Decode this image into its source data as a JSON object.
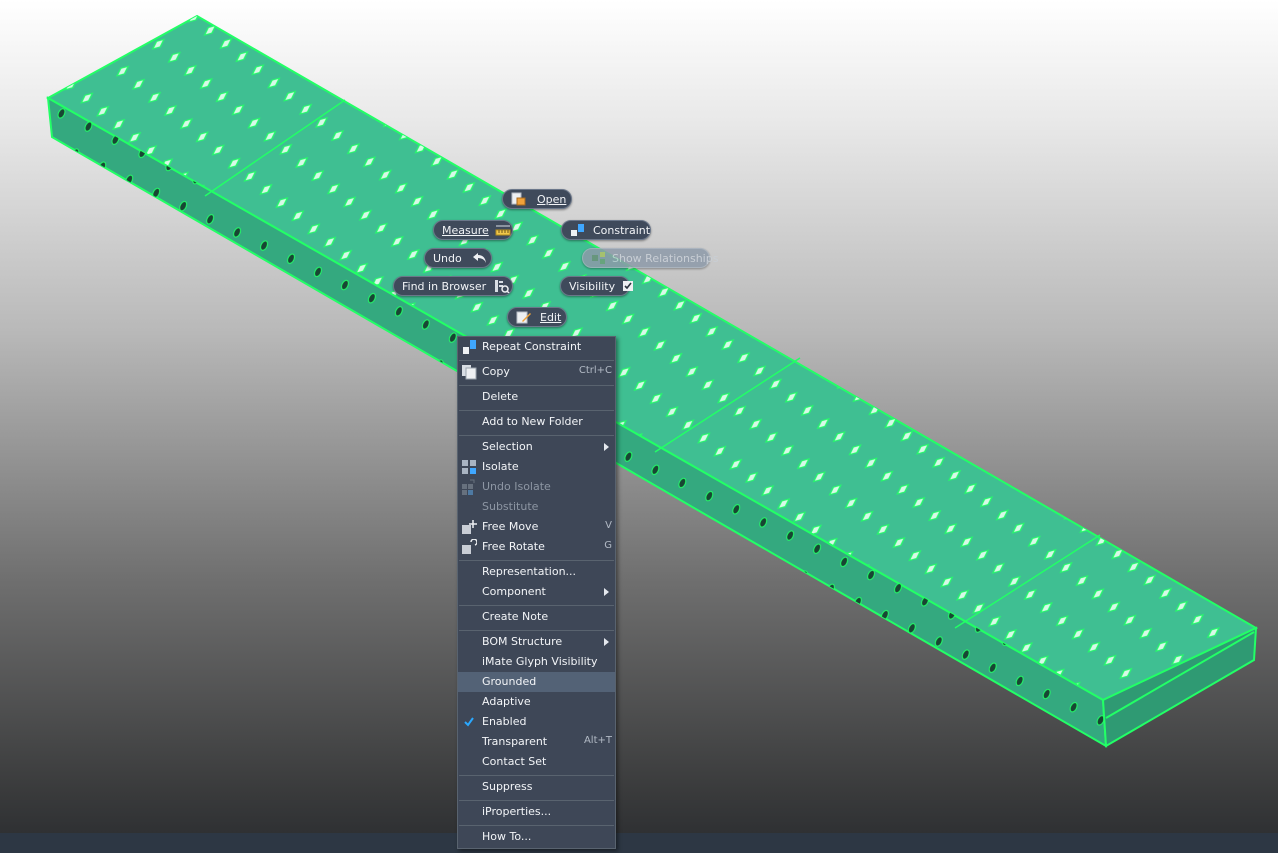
{
  "marking_menu": {
    "open": "Open",
    "measure": "Measure",
    "constraint": "Constraint",
    "undo": "Undo",
    "show_relationships": "Show Relationships",
    "find_in_browser": "Find in Browser",
    "visibility": "Visibility",
    "edit": "Edit"
  },
  "context_menu": {
    "items": [
      {
        "label": "Repeat Constraint",
        "icon": "constraint-icon"
      },
      {
        "label": "Copy",
        "shortcut": "Ctrl+C",
        "icon": "copy-icon"
      },
      {
        "label": "Delete"
      },
      {
        "label": "Add to New Folder"
      },
      {
        "label": "Selection",
        "submenu": true
      },
      {
        "label": "Isolate",
        "icon": "isolate-icon"
      },
      {
        "label": "Undo Isolate",
        "icon": "undo-isolate-icon",
        "disabled": true
      },
      {
        "label": "Substitute",
        "disabled": true
      },
      {
        "label": "Free Move",
        "shortcut": "V",
        "icon": "free-move-icon"
      },
      {
        "label": "Free Rotate",
        "shortcut": "G",
        "icon": "free-rotate-icon"
      },
      {
        "label": "Representation..."
      },
      {
        "label": "Component",
        "submenu": true
      },
      {
        "label": "Create Note"
      },
      {
        "label": "BOM Structure",
        "submenu": true
      },
      {
        "label": "iMate Glyph Visibility"
      },
      {
        "label": "Grounded",
        "hovered": true
      },
      {
        "label": "Adaptive"
      },
      {
        "label": "Enabled",
        "checked": true
      },
      {
        "label": "Transparent",
        "shortcut": "Alt+T"
      },
      {
        "label": "Contact Set"
      },
      {
        "label": "Suppress"
      },
      {
        "label": "iProperties..."
      },
      {
        "label": "How To..."
      }
    ]
  },
  "colors": {
    "part_fill": "#3fbf92",
    "part_highlight": "#22ff66",
    "menu_bg": "#3e4757",
    "menu_hover": "#536276",
    "check_blue": "#2aa8ff"
  }
}
